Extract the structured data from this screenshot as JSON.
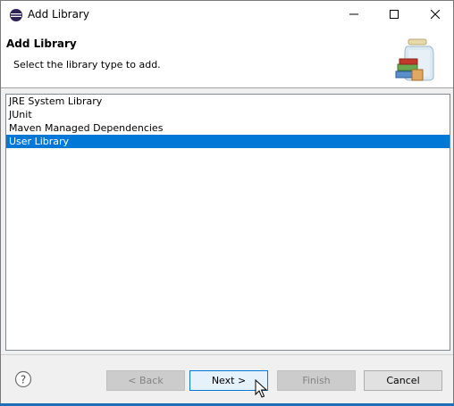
{
  "window": {
    "title": "Add Library",
    "controls": {
      "minimize_icon": "minimize-icon",
      "maximize_icon": "maximize-icon",
      "close_icon": "close-icon"
    }
  },
  "header": {
    "title": "Add Library",
    "description": "Select the library type to add."
  },
  "library_types": [
    {
      "label": "JRE System Library",
      "selected": false
    },
    {
      "label": "JUnit",
      "selected": false
    },
    {
      "label": "Maven Managed Dependencies",
      "selected": false
    },
    {
      "label": "User Library",
      "selected": true
    }
  ],
  "buttons": {
    "back": "< Back",
    "next": "Next >",
    "finish": "Finish",
    "cancel": "Cancel"
  },
  "colors": {
    "selection": "#0078d7",
    "header_bg": "#ffffff",
    "dialog_bg": "#f0f0f0"
  }
}
